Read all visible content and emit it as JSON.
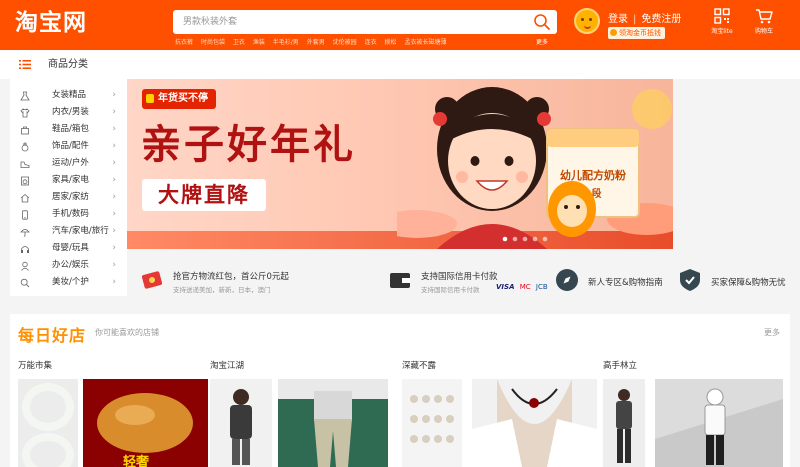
{
  "header": {
    "logo": "淘宝网",
    "search": {
      "placeholder": "男款秋装外套",
      "icon": "search-icon"
    },
    "hot_words": [
      "抗衣裤",
      "时尚包袋",
      "卫衣",
      "渔装",
      "半毛衫/男",
      "外套男",
      "沈伦被园",
      "连衣",
      "拨松",
      "孟衣被长磁塘薄"
    ],
    "hot_more": "更多",
    "login": "登录",
    "register": "免费注册",
    "vip_badge": "领淘金币抵钱",
    "tools": [
      {
        "label": "淘宝lite",
        "icon": "qr-code-icon"
      },
      {
        "label": "购物车",
        "icon": "cart-icon"
      }
    ],
    "colors": {
      "brand": "#ff5000"
    }
  },
  "category_bar": {
    "label": "商品分类",
    "icon": "list-icon"
  },
  "side_menu": [
    {
      "label": "女装精品",
      "icon": "dress-icon"
    },
    {
      "label": "内衣/男装",
      "icon": "shirt-icon"
    },
    {
      "label": "鞋品/箱包",
      "icon": "bag-icon"
    },
    {
      "label": "饰品/配件",
      "icon": "ring-icon"
    },
    {
      "label": "运动/户外",
      "icon": "shoe-icon"
    },
    {
      "label": "家具/家电",
      "icon": "washer-icon"
    },
    {
      "label": "居家/家纺",
      "icon": "home-icon"
    },
    {
      "label": "手机/数码",
      "icon": "phone-icon"
    },
    {
      "label": "汽车/家电/旅行",
      "icon": "umbrella-icon"
    },
    {
      "label": "母婴/玩具",
      "icon": "headphones-icon"
    },
    {
      "label": "办公/娱乐",
      "icon": "baby-icon"
    },
    {
      "label": "美妆/个护",
      "icon": "search-icon"
    }
  ],
  "banner": {
    "tag": "年货买不停",
    "title": "亲子好年礼",
    "subtitle": "大牌直降",
    "product_text": "幼儿配方奶粉",
    "product_stage": "3段",
    "dots": 5
  },
  "features": [
    {
      "title": "抢官方物流红包，首公斤0元起",
      "subtitle": "支持送递美加，新新，日本，澳门",
      "icon": "red-packet-icon"
    },
    {
      "title": "支持国际信用卡付款",
      "subtitle": "支持国际信用卡付款",
      "icon": "wallet-icon",
      "logos": [
        "VISA",
        "MC",
        "JCB"
      ]
    },
    {
      "title": "新人专区&购物指南",
      "subtitle": "",
      "icon": "compass-icon"
    },
    {
      "title": "买家保障&购物无忧",
      "subtitle": "",
      "icon": "shield-icon"
    }
  ],
  "shops": {
    "brand": "每日好店",
    "description": "你可能喜欢的店铺",
    "more": "更多",
    "columns": [
      {
        "title": "万能市集",
        "promo": "轻奢"
      },
      {
        "title": "淘宝江湖"
      },
      {
        "title": "深藏不露"
      },
      {
        "title": "高手林立"
      }
    ]
  }
}
